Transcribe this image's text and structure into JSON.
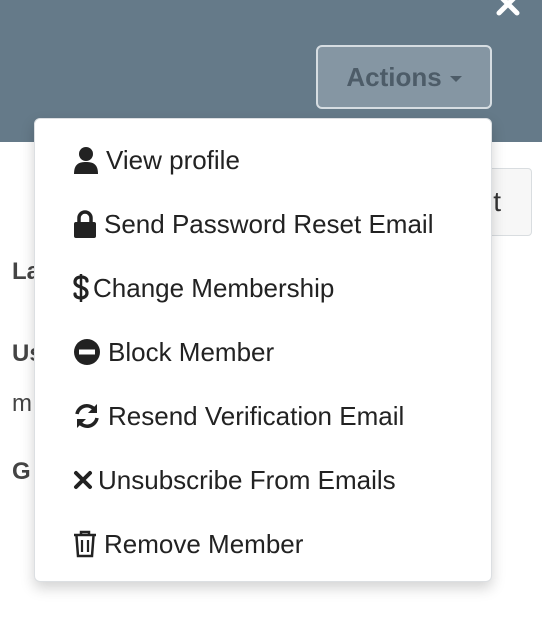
{
  "header": {
    "close_icon": "close-icon",
    "actions_label": "Actions"
  },
  "background": {
    "button_partial": "t",
    "label_1": "La",
    "label_2": "Us",
    "label_3": "m",
    "label_4": "G"
  },
  "menu": {
    "items": [
      {
        "icon": "user-icon",
        "label": "View profile"
      },
      {
        "icon": "lock-icon",
        "label": "Send Password Reset Email"
      },
      {
        "icon": "dollar-icon",
        "label": "Change Membership"
      },
      {
        "icon": "minus-circle-icon",
        "label": "Block Member"
      },
      {
        "icon": "refresh-icon",
        "label": "Resend Verification Email"
      },
      {
        "icon": "times-icon",
        "label": "Unsubscribe From Emails"
      },
      {
        "icon": "trash-icon",
        "label": "Remove Member"
      }
    ]
  },
  "colors": {
    "header_bg": "#657a89",
    "menu_text": "#222222"
  }
}
